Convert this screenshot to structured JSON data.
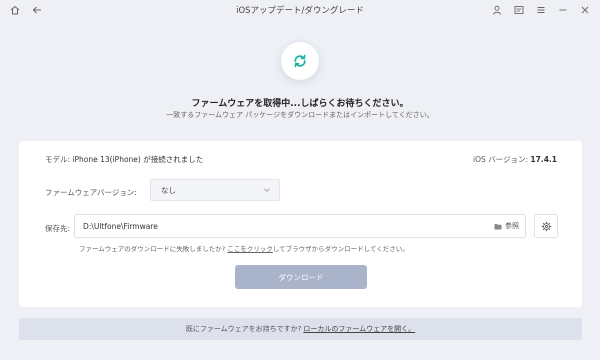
{
  "window": {
    "title": "iOSアップデート/ダウングレード"
  },
  "hero": {
    "title": "ファームウェアを取得中...しばらくお待ちください。",
    "subtitle": "一致するファームウェア パッケージをダウンロードまたはインポートしてください。"
  },
  "device": {
    "model_label": "モデル:",
    "model_value": "iPhone 13(iPhone) が接続されました",
    "ios_label": "iOS バージョン:",
    "ios_value": "17.4.1"
  },
  "firmware": {
    "version_label": "ファームウェアバージョン:",
    "version_value": "なし"
  },
  "save": {
    "label": "保存先:",
    "path": "D:\\Ultfone\\Firmware",
    "browse_label": "参照"
  },
  "fail": {
    "prefix": "ファームウェアのダウンロードに失敗しましたか?",
    "link": "ここをクリック",
    "suffix": "してブラウザからダウンロードしてください。"
  },
  "download_button": "ダウンロード",
  "bottom": {
    "prefix": "既にファームウェアをお持ちですか?",
    "link": "ローカルのファームウェアを開く。"
  },
  "colors": {
    "accent_teal": "#1bb5a4",
    "button_disabled": "#a9b3c9",
    "background": "#eef0f6"
  }
}
